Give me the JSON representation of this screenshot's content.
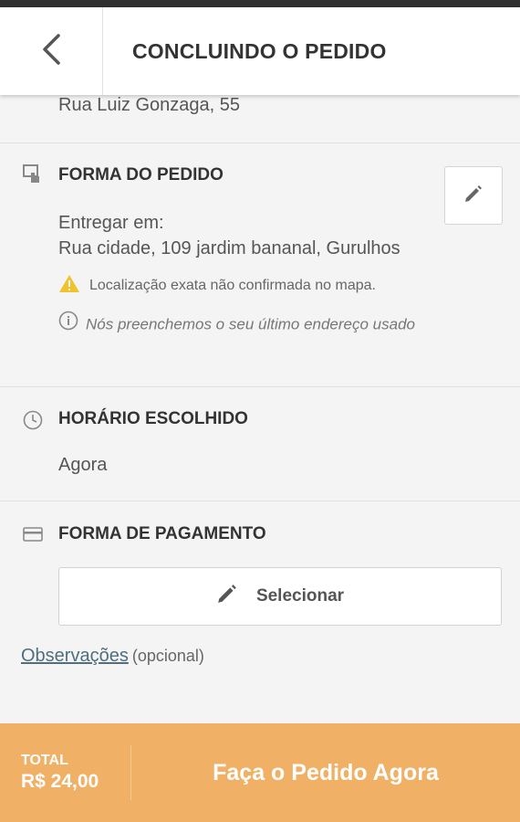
{
  "header": {
    "title": "CONCLUINDO O PEDIDO",
    "back_icon": "chevron-left-icon"
  },
  "address_top": "Rua Luiz Gonzaga, 55",
  "order_form": {
    "title": "FORMA DO PEDIDO",
    "deliver_label": "Entregar em:",
    "address": "Rua cidade, 109 jardim bananal, Gurulhos",
    "warning": "Localização exata não confirmada no mapa.",
    "info": "Nós preenchemos o seu último endereço usado",
    "edit_icon": "pencil-icon"
  },
  "schedule": {
    "title": "HORÁRIO ESCOLHIDO",
    "value": "Agora"
  },
  "payment": {
    "title": "FORMA DE PAGAMENTO",
    "select_label": "Selecionar"
  },
  "observations": {
    "link": "Observações",
    "optional": "(opcional)"
  },
  "footer": {
    "total_label": "TOTAL",
    "total_value": "R$ 24,00",
    "order_button": "Faça o Pedido Agora"
  },
  "colors": {
    "accent": "#f0b065",
    "warning": "#f2c12e",
    "link": "#4f6f7f"
  }
}
